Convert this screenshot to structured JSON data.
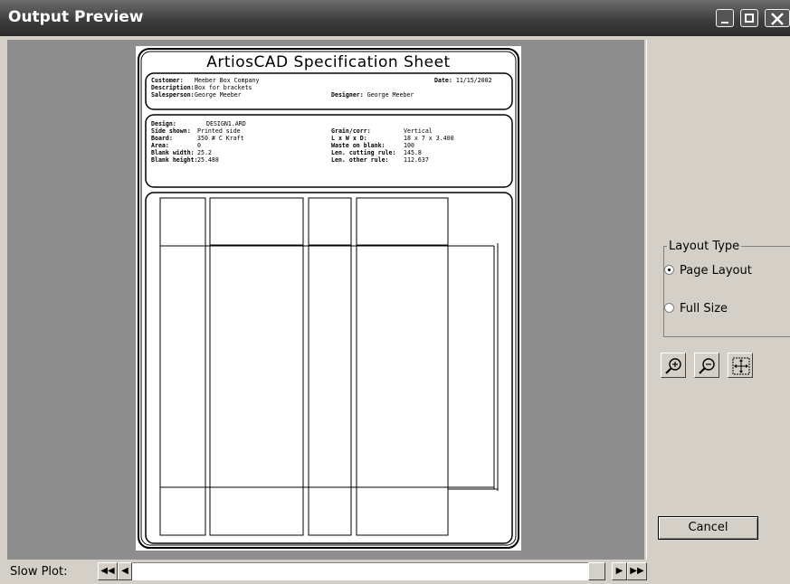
{
  "window": {
    "title": "Output Preview"
  },
  "sheet": {
    "title": "ArtiosCAD Specification Sheet",
    "customer_label": "Customer:",
    "customer_value": "Meeber Box Company",
    "description_label": "Description:",
    "description_value": "Box for brackets",
    "salesperson_label": "Salesperson:",
    "salesperson_value": "George Meeber",
    "date_label": "Date:",
    "date_value": "11/15/2002",
    "designer_label": "Designer:",
    "designer_value": "George Meeber",
    "design_label": "Design:",
    "design_value": "DESIGN1.ARD",
    "side_label": "Side shown:",
    "side_value": "Printed side",
    "board_label": "Board:",
    "board_value": "350 # C Kraft",
    "area_label": "Area:",
    "area_value": "0",
    "blank_width_label": "Blank width:",
    "blank_width_value": "25.2",
    "blank_height_label": "Blank height:",
    "blank_height_value": "25.488",
    "grain_label": "Grain/corr:",
    "grain_value": "Vertical",
    "lwd_label": "L x W x D:",
    "lwd_value": "18 x 7 x 3.400",
    "waste_label": "Waste on blank:",
    "waste_value": "100",
    "cutting_label": "Len. cutting rule:",
    "cutting_value": "145.8",
    "other_label": "Len. other rule:",
    "other_value": "112.637"
  },
  "layout_type": {
    "group_label": "Layout Type",
    "options": [
      {
        "label": "Page Layout",
        "checked": true
      },
      {
        "label": "Full Size",
        "checked": false
      }
    ]
  },
  "tools": [
    "zoom-in-icon",
    "zoom-out-icon",
    "fit-to-window-icon"
  ],
  "cancel_label": "Cancel",
  "slow_plot": {
    "label": "Slow Plot:",
    "first": "◀◀",
    "prev": "◀",
    "next": "▶",
    "last": "▶▶"
  }
}
